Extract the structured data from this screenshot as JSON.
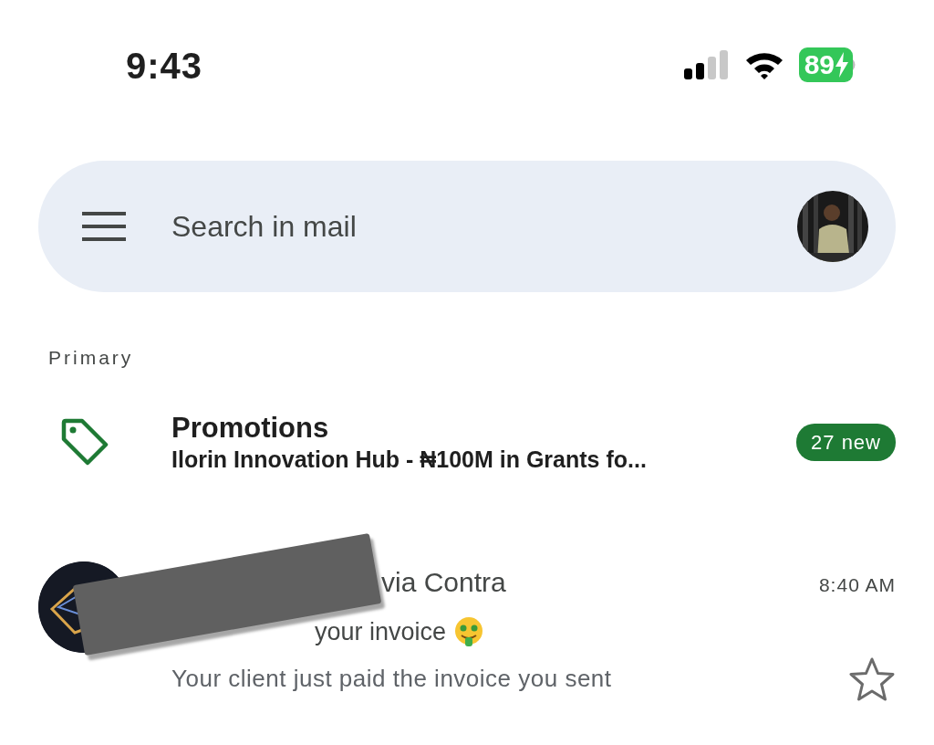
{
  "status_bar": {
    "time": "9:43",
    "battery": "89",
    "charging": true
  },
  "search": {
    "placeholder": "Search in mail"
  },
  "section": "Primary",
  "promotions": {
    "title": "Promotions",
    "snippet": "Ilorin Innovation Hub - ₦100M in Grants fo...",
    "badge": "27 new"
  },
  "emails": [
    {
      "sender": "via Contra",
      "time": "8:40 AM",
      "subject": "your invoice",
      "snippet": "Your client just paid the invoice you sent",
      "starred": false,
      "redacted": true
    }
  ]
}
